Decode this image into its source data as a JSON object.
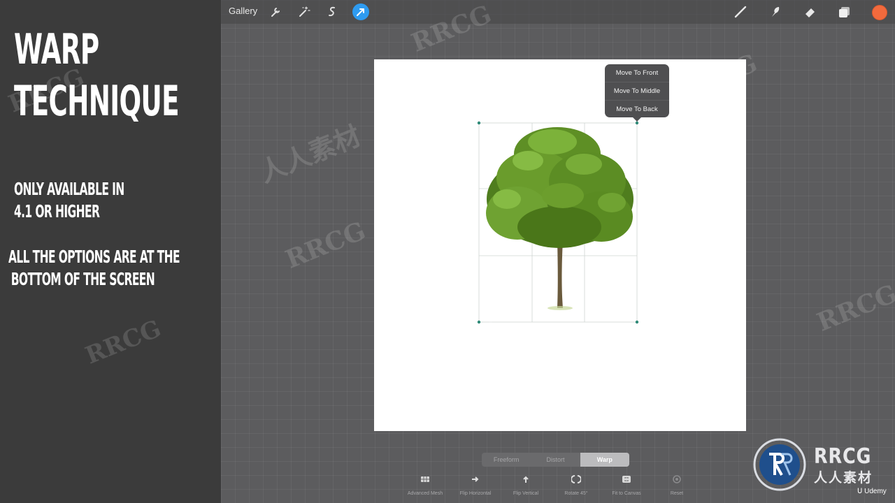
{
  "left_panel": {
    "title_line1": "WARP",
    "title_line2": "TECHNIQUE",
    "note1_line1": "ONLY AVAILABLE IN",
    "note1_line2": "4.1 OR HIGHER",
    "note2_line1": "ALL THE OPTIONS ARE AT THE",
    "note2_line2": "BOTTOM OF THE SCREEN"
  },
  "toolbar": {
    "gallery_label": "Gallery",
    "left_icons": [
      "wrench-icon",
      "magic-wand-icon",
      "selection-icon",
      "transform-arrow-icon"
    ],
    "right_icons": [
      "brush-icon",
      "smudge-icon",
      "eraser-icon",
      "layers-icon"
    ],
    "color_swatch": "#f26a3d",
    "active_tool_color": "#2e9bf0"
  },
  "popup_menu": {
    "items": [
      "Move To Front",
      "Move To Middle",
      "Move To Back"
    ]
  },
  "transform_modes": {
    "options": [
      "Freeform",
      "Distort",
      "Warp"
    ],
    "selected": "Warp"
  },
  "bottom_toolbar": {
    "items": [
      {
        "label": "Advanced Mesh",
        "icon": "mesh-grid-icon"
      },
      {
        "label": "Flip Horizontal",
        "icon": "arrow-right-icon"
      },
      {
        "label": "Flip Vertical",
        "icon": "arrow-up-icon"
      },
      {
        "label": "Rotate 45°",
        "icon": "rotate-icon"
      },
      {
        "label": "Fit to Canvas",
        "icon": "fit-canvas-icon"
      },
      {
        "label": "Reset",
        "icon": "reset-icon"
      }
    ]
  },
  "watermark": {
    "brand": "RRCG",
    "brand_cn": "人人素材",
    "udemy": "Udemy"
  }
}
